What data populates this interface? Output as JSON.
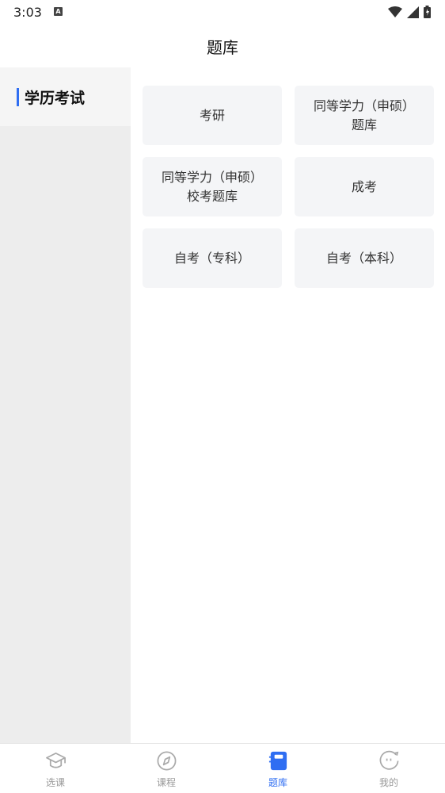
{
  "status_bar": {
    "time": "3:03",
    "notification_glyph": "A"
  },
  "header": {
    "title": "题库"
  },
  "sidebar": {
    "items": [
      {
        "label": "学历考试",
        "selected": true
      }
    ]
  },
  "cards": [
    {
      "label": "考研"
    },
    {
      "label": "同等学力（申硕）\n题库"
    },
    {
      "label": "同等学力（申硕）\n校考题库"
    },
    {
      "label": "成考"
    },
    {
      "label": "自考（专科）"
    },
    {
      "label": "自考（本科）"
    }
  ],
  "tabbar": {
    "tabs": [
      {
        "label": "选课",
        "icon": "graduation-cap-icon"
      },
      {
        "label": "课程",
        "icon": "compass-icon"
      },
      {
        "label": "题库",
        "icon": "book-icon",
        "active": true
      },
      {
        "label": "我的",
        "icon": "smiley-icon"
      }
    ]
  },
  "colors": {
    "accent": "#2f6ef2",
    "sidebar_bg": "#ededed",
    "card_bg": "#f4f5f7",
    "inactive_tab": "#999999"
  }
}
